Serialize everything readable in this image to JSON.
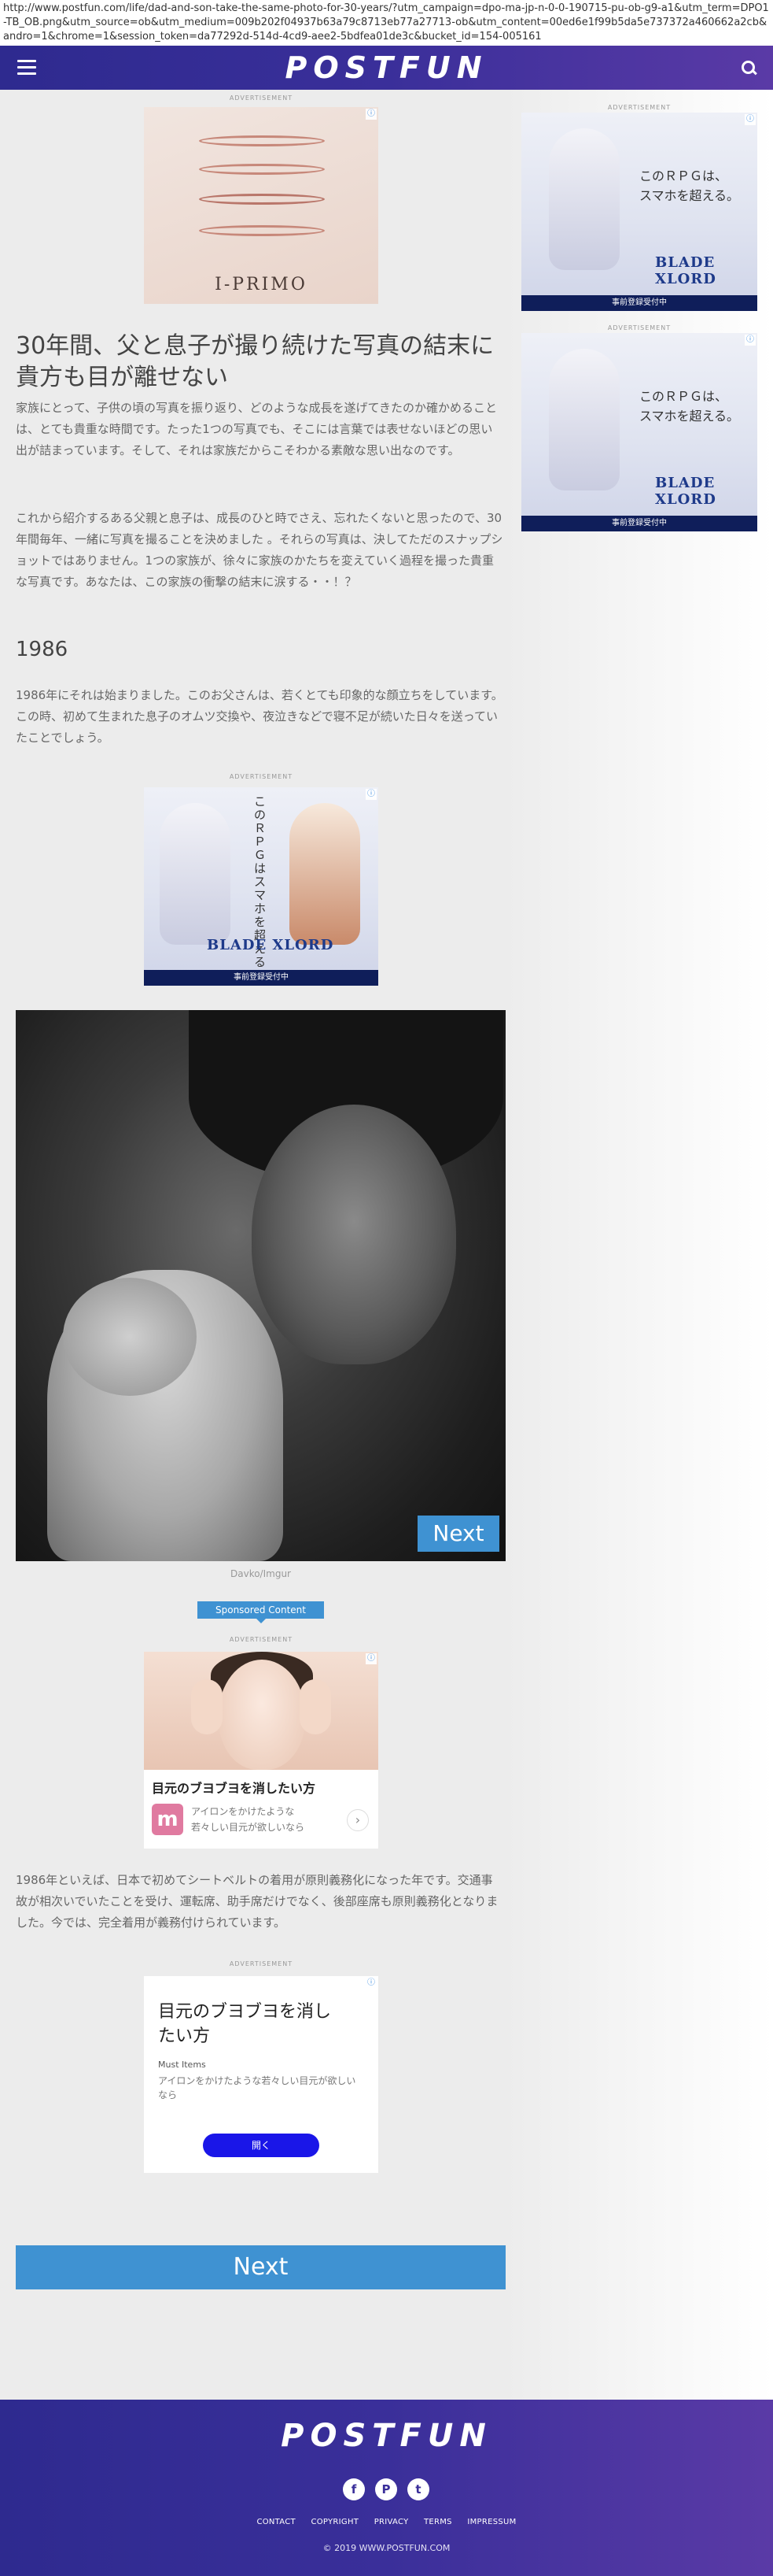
{
  "browser": {
    "url": "http://www.postfun.com/life/dad-and-son-take-the-same-photo-for-30-years/?utm_campaign=dpo-ma-jp-n-0-0-190715-pu-ob-g9-a1&utm_term=DPO1-TB_OB.png&utm_source=ob&utm_medium=009b202f04937b63a79c8713eb77a27713-ob&utm_content=00ed6e1f99b5da5e737372a460662a2cb&andro=1&chrome=1&session_token=da77292d-514d-4cd9-aee2-5bdfea01de3c&bucket_id=154-005161"
  },
  "header": {
    "logo": "POSTFUN"
  },
  "ads": {
    "label": "ADVERTISEMENT",
    "close_glyph": "ⓘ",
    "ring_brand": "I-PRIMO",
    "game_text_1": "このＲＰＧは、",
    "game_text_2": "スマホを超える。",
    "game_vertical": "このＲＰＧはスマホを超える",
    "game_logo": "BLADE XLORD",
    "game_band": "事前登録受付中",
    "beauty_headline": "目元のブヨブヨを消したい方",
    "beauty_sub_1": "アイロンをかけたような",
    "beauty_sub_2": "若々しい目元が欲しいなら",
    "beauty_icon_letter": "m",
    "beauty_arrow": "›",
    "text_ad_headline": "目元のブヨブヨを消したい方",
    "text_ad_sponsor": "Must Items",
    "text_ad_desc": "アイロンをかけたような若々しい目元が欲しいなら",
    "text_ad_button": "開く"
  },
  "article": {
    "title": "30年間、父と息子が撮り続けた写真の結末に貴方も目が離せない",
    "para1": "家族にとって、子供の頃の写真を振り返り、どのような成長を遂げてきたのか確かめることは、とても貴重な時間です。たった1つの写真でも、そこには言葉では表せないほどの思い出が詰まっています。そして、それは家族だからこそわかる素敵な思い出なのです。",
    "para2": "これから紹介するある父親と息子は、成長のひと時でさえ、忘れたくないと思ったので、30年間毎年、一緒に写真を撮ることを決めました 。それらの写真は、決してただのスナップショットではありません。1つの家族が、徐々に家族のかたちを変えていく過程を撮った貴重な写真です。あなたは、この家族の衝撃の結末に涙する・・！？",
    "subheading": "1986",
    "para3": "1986年にそれは始まりました。このお父さんは、若くとても印象的な顔立ちをしています。この時、初めて生まれた息子のオムツ交換や、夜泣きなどで寝不足が続いた日々を送っていたことでしょう。",
    "photo_next": "Next",
    "photo_credit": "Davko/Imgur",
    "sponsored_label": "Sponsored Content",
    "para4": "1986年といえば、日本で初めてシートベルトの着用が原則義務化になった年です。交通事故が相次いでいたことを受け、運転席、助手席だけでなく、後部座席も原則義務化となりました。今では、完全着用が義務付けられています。",
    "next_button": "Next"
  },
  "footer": {
    "logo": "POSTFUN",
    "social": {
      "facebook": "f",
      "pinterest": "P",
      "twitter": "t"
    },
    "links": [
      "CONTACT",
      "COPYRIGHT",
      "PRIVACY",
      "TERMS",
      "IMPRESSUM"
    ],
    "copyright": "© 2019 WWW.POSTFUN.COM"
  }
}
